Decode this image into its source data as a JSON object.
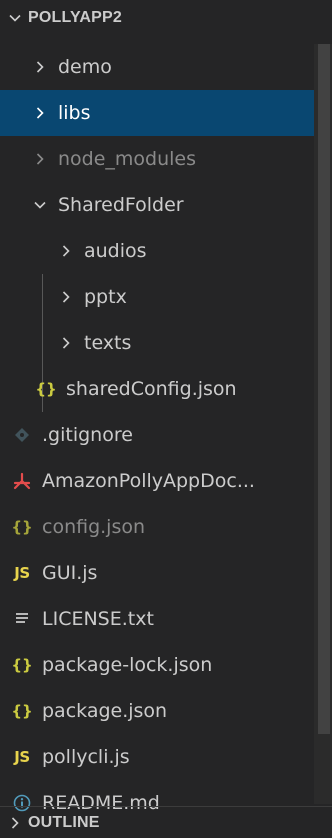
{
  "explorer": {
    "project_title": "POLLYAPP2",
    "outline_title": "OUTLINE",
    "items": [
      {
        "label": "demo",
        "type": "folder",
        "expanded": false
      },
      {
        "label": "libs",
        "type": "folder",
        "expanded": false,
        "selected": true
      },
      {
        "label": "node_modules",
        "type": "folder",
        "expanded": false,
        "dimmed": true
      },
      {
        "label": "SharedFolder",
        "type": "folder",
        "expanded": true
      },
      {
        "label": "audios",
        "type": "folder",
        "expanded": false
      },
      {
        "label": "pptx",
        "type": "folder",
        "expanded": false
      },
      {
        "label": "texts",
        "type": "folder",
        "expanded": false
      },
      {
        "label": "sharedConfig.json",
        "type": "file",
        "icon": "json-braces-icon"
      },
      {
        "label": ".gitignore",
        "type": "file",
        "icon": "git-diamond-icon"
      },
      {
        "label": "AmazonPollyAppDoc...",
        "type": "file",
        "icon": "pdf-icon"
      },
      {
        "label": "config.json",
        "type": "file",
        "icon": "json-braces-icon",
        "dimmed": true
      },
      {
        "label": "GUI.js",
        "type": "file",
        "icon": "js-icon"
      },
      {
        "label": "LICENSE.txt",
        "type": "file",
        "icon": "text-lines-icon"
      },
      {
        "label": "package-lock.json",
        "type": "file",
        "icon": "json-braces-icon"
      },
      {
        "label": "package.json",
        "type": "file",
        "icon": "json-braces-icon"
      },
      {
        "label": "pollycli.js",
        "type": "file",
        "icon": "js-icon"
      },
      {
        "label": "README.md",
        "type": "file",
        "icon": "info-icon"
      }
    ],
    "icon_text": {
      "braces": "{}",
      "js": "JS"
    }
  },
  "colors": {
    "background": "#252526",
    "selected": "#094771",
    "json_icon": "#cbcb41",
    "js_icon": "#e8d44d",
    "pdf_icon": "#e34c4c",
    "info_icon": "#519aba"
  }
}
